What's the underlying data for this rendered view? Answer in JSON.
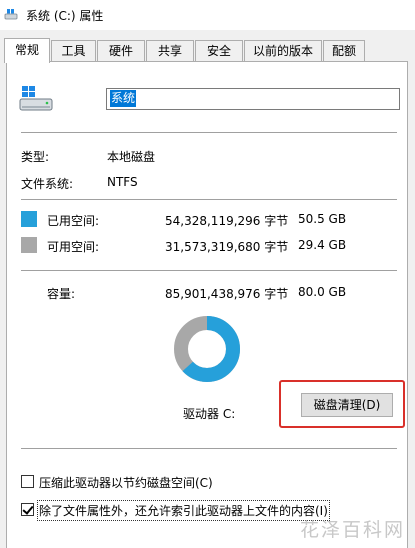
{
  "window": {
    "title": "系统 (C:) 属性",
    "icon": "drive-icon"
  },
  "tabs": [
    {
      "label": "常规",
      "active": true
    },
    {
      "label": "工具"
    },
    {
      "label": "硬件"
    },
    {
      "label": "共享"
    },
    {
      "label": "安全"
    },
    {
      "label": "以前的版本"
    },
    {
      "label": "配额"
    }
  ],
  "drive": {
    "name": "系统",
    "icon": "windows-drive-icon"
  },
  "info": {
    "type_label": "类型:",
    "type_value": "本地磁盘",
    "fs_label": "文件系统:",
    "fs_value": "NTFS"
  },
  "space": {
    "used": {
      "label": "已用空间:",
      "bytes": "54,328,119,296 字节",
      "size": "50.5 GB",
      "color": "#26a0da"
    },
    "free": {
      "label": "可用空间:",
      "bytes": "31,573,319,680 字节",
      "size": "29.4 GB",
      "color": "#a8a8a8"
    },
    "capacity": {
      "label": "容量:",
      "bytes": "85,901,438,976 字节",
      "size": "80.0 GB"
    },
    "used_fraction": 0.632
  },
  "drive_label": "驱动器 C:",
  "cleanup_button": "磁盘清理(D)",
  "options": {
    "compress": {
      "label": "压缩此驱动器以节约磁盘空间(C)",
      "checked": false
    },
    "index": {
      "label": "除了文件属性外，还允许索引此驱动器上文件的内容(I)",
      "checked": true
    }
  },
  "watermark": "花泽百科网"
}
